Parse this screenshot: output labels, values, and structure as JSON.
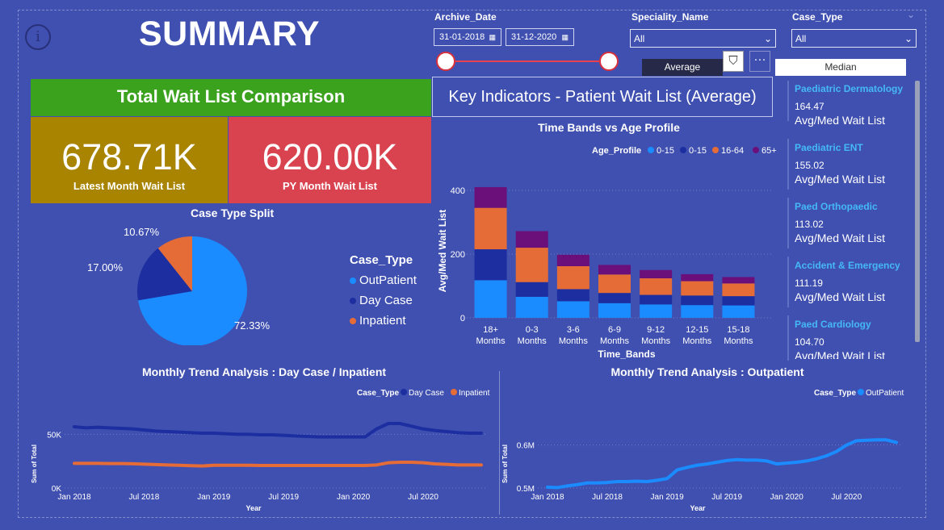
{
  "title": "SUMMARY",
  "filters": {
    "archive_label": "Archive_Date",
    "date_from": "31-01-2018",
    "date_to": "31-12-2020",
    "speciality_label": "Speciality_Name",
    "speciality_value": "All",
    "case_type_label": "Case_Type",
    "case_type_value": "All",
    "toggle_average": "Average",
    "toggle_median": "Median"
  },
  "kpi": {
    "heading": "Total Wait List Comparison",
    "latest_value": "678.71K",
    "latest_label": "Latest Month Wait List",
    "py_value": "620.00K",
    "py_label": "PY Month Wait List"
  },
  "key_indicators": {
    "title": "Key Indicators - Patient Wait List (Average)"
  },
  "pie": {
    "title": "Case Type Split",
    "legend_title": "Case_Type",
    "labels": [
      "OutPatient",
      "Day Case",
      "Inpatient"
    ],
    "pct_labels": [
      "72.33%",
      "17.00%",
      "10.67%"
    ]
  },
  "specialities": [
    {
      "name": "Paediatric Dermatology",
      "value": "164.47",
      "label": "Avg/Med Wait List"
    },
    {
      "name": "Paediatric ENT",
      "value": "155.02",
      "label": "Avg/Med Wait List"
    },
    {
      "name": "Paed Orthopaedic",
      "value": "113.02",
      "label": "Avg/Med Wait List"
    },
    {
      "name": "Accident & Emergency",
      "value": "111.19",
      "label": "Avg/Med Wait List"
    },
    {
      "name": "Paed Cardiology",
      "value": "104.70",
      "label": "Avg/Med Wait List"
    }
  ],
  "colors": {
    "outpatient": "#1a8cff",
    "daycase": "#1c2ea0",
    "inpatient": "#e66c37",
    "age65": "#6b107a",
    "kpi_green": "#3aa21c",
    "kpi_olive": "#a88400",
    "kpi_red": "#d9434f",
    "background": "#4050b0"
  },
  "chart_data": [
    {
      "type": "pie",
      "title": "Case Type Split",
      "categories": [
        "OutPatient",
        "Day Case",
        "Inpatient"
      ],
      "values": [
        72.33,
        17.0,
        10.67
      ]
    },
    {
      "type": "bar",
      "title": "Time Bands vs Age Profile",
      "xlabel": "Time_Bands",
      "ylabel": "Avg/Med Wait List",
      "legend_title": "Age_Profile",
      "categories": [
        "18+ Months",
        "0-3 Months",
        "3-6 Months",
        "6-9 Months",
        "9-12 Months",
        "12-15 Months",
        "15-18 Months"
      ],
      "series": [
        {
          "name": "0-15",
          "values": [
            118,
            66,
            52,
            46,
            42,
            40,
            39
          ]
        },
        {
          "name": "0-15",
          "values": [
            97,
            46,
            38,
            32,
            30,
            30,
            29
          ]
        },
        {
          "name": "16-64",
          "values": [
            130,
            108,
            72,
            58,
            52,
            45,
            40
          ]
        },
        {
          "name": "65+",
          "values": [
            65,
            52,
            36,
            30,
            26,
            22,
            20
          ]
        }
      ],
      "ylim": [
        0,
        420
      ],
      "yticks": [
        0,
        200,
        400
      ]
    },
    {
      "type": "line",
      "title": "Monthly Trend Analysis : Day Case / Inpatient",
      "xlabel": "Year",
      "ylabel": "Sum of Total",
      "legend_title": "Case_Type",
      "x_ticks": [
        "Jan 2018",
        "Jul 2018",
        "Jan 2019",
        "Jul 2019",
        "Jan 2020",
        "Jul 2020"
      ],
      "y_ticks": [
        "0K",
        "50K"
      ],
      "ylim": [
        0,
        60
      ],
      "x": [
        "2018-01",
        "2018-02",
        "2018-03",
        "2018-04",
        "2018-05",
        "2018-06",
        "2018-07",
        "2018-08",
        "2018-09",
        "2018-10",
        "2018-11",
        "2018-12",
        "2019-01",
        "2019-02",
        "2019-03",
        "2019-04",
        "2019-05",
        "2019-06",
        "2019-07",
        "2019-08",
        "2019-09",
        "2019-10",
        "2019-11",
        "2019-12",
        "2020-01",
        "2020-02",
        "2020-03",
        "2020-04",
        "2020-05",
        "2020-06",
        "2020-07",
        "2020-08",
        "2020-09",
        "2020-10",
        "2020-11",
        "2020-12"
      ],
      "series": [
        {
          "name": "Day Case",
          "values": [
            57,
            56,
            56.5,
            56,
            55.5,
            55,
            54,
            53,
            52.5,
            52,
            51.5,
            51,
            51,
            50.5,
            50,
            50,
            49.5,
            49.5,
            49,
            48.5,
            48,
            47.5,
            47.5,
            47.5,
            47.5,
            47.5,
            55,
            60,
            60,
            57.5,
            55,
            53.5,
            52.5,
            51.5,
            51,
            51
          ]
        },
        {
          "name": "Inpatient",
          "values": [
            23,
            23,
            23,
            22.8,
            22.8,
            22.6,
            22.2,
            21.8,
            21.5,
            21.2,
            20.8,
            20.5,
            21.2,
            21.2,
            21.2,
            21.2,
            21,
            21,
            21,
            21,
            21,
            21,
            21,
            21,
            21,
            21,
            21.5,
            23.5,
            24,
            24,
            23.5,
            22.5,
            22,
            21.5,
            21.5,
            21.5
          ]
        }
      ]
    },
    {
      "type": "line",
      "title": "Monthly Trend Analysis : Outpatient",
      "xlabel": "Year",
      "ylabel": "Sum of Total",
      "legend_title": "Case_Type",
      "x_ticks": [
        "Jan 2018",
        "Jul 2018",
        "Jan 2019",
        "Jul 2019",
        "Jan 2020",
        "Jul 2020"
      ],
      "y_ticks": [
        "0.5M",
        "0.6M"
      ],
      "ylim": [
        0.5,
        0.65
      ],
      "x": [
        "2018-01",
        "2018-02",
        "2018-03",
        "2018-04",
        "2018-05",
        "2018-06",
        "2018-07",
        "2018-08",
        "2018-09",
        "2018-10",
        "2018-11",
        "2018-12",
        "2019-01",
        "2019-02",
        "2019-03",
        "2019-04",
        "2019-05",
        "2019-06",
        "2019-07",
        "2019-08",
        "2019-09",
        "2019-10",
        "2019-11",
        "2019-12",
        "2020-01",
        "2020-02",
        "2020-03",
        "2020-04",
        "2020-05",
        "2020-06",
        "2020-07",
        "2020-08",
        "2020-09",
        "2020-10",
        "2020-11",
        "2020-12"
      ],
      "series": [
        {
          "name": "OutPatient",
          "values": [
            0.502,
            0.501,
            0.505,
            0.508,
            0.512,
            0.512,
            0.513,
            0.515,
            0.515,
            0.516,
            0.515,
            0.518,
            0.522,
            0.542,
            0.548,
            0.553,
            0.556,
            0.56,
            0.564,
            0.566,
            0.565,
            0.565,
            0.563,
            0.556,
            0.558,
            0.56,
            0.563,
            0.568,
            0.575,
            0.585,
            0.6,
            0.61,
            0.611,
            0.612,
            0.612,
            0.606
          ]
        }
      ]
    }
  ]
}
